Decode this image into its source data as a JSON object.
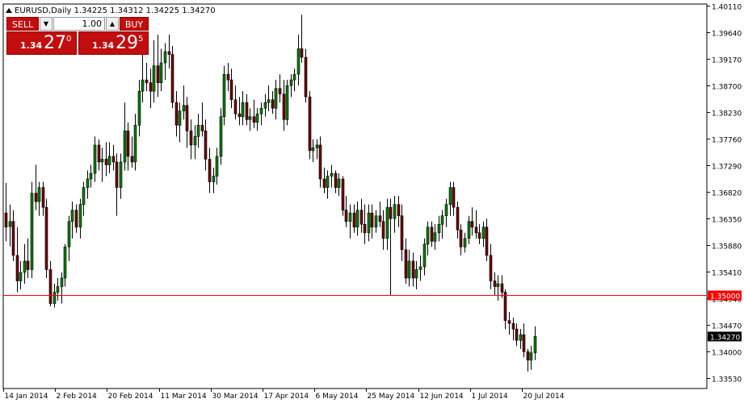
{
  "window": {
    "header_text": "EURUSD,Daily  1.34225 1.34312 1.34225 1.34270"
  },
  "trade_panel": {
    "sell_label": "SELL",
    "buy_label": "BUY",
    "lot_value": "1.00",
    "sell_price_prefix": "1.34",
    "sell_price_big": "27",
    "sell_price_super": "0",
    "buy_price_prefix": "1.34",
    "buy_price_big": "29",
    "buy_price_super": "5"
  },
  "chart_data": {
    "type": "candlestick",
    "symbol": "EURUSD",
    "timeframe": "Daily",
    "ohlc_header": {
      "open": 1.34225,
      "high": 1.34312,
      "low": 1.34225,
      "close": 1.3427
    },
    "x_tick_labels": [
      "14 Jan 2014",
      "2 Feb 2014",
      "20 Feb 2014",
      "11 Mar 2014",
      "30 Mar 2014",
      "17 Apr 2014",
      "6 May 2014",
      "25 May 2014",
      "12 Jun 2014",
      "1 Jul 2014",
      "20 Jul 2014"
    ],
    "y_tick_labels": [
      "1.40110",
      "1.39640",
      "1.39170",
      "1.38700",
      "1.38230",
      "1.37760",
      "1.37290",
      "1.36820",
      "1.36350",
      "1.35880",
      "1.35410",
      "1.34940",
      "1.34470",
      "1.34000",
      "1.33530"
    ],
    "y_range": [
      1.3335,
      1.4014
    ],
    "horizontal_line": {
      "value": 1.35,
      "label": "1.35000",
      "color": "#ff0000"
    },
    "current_price_label": "1.34270",
    "colors": {
      "bull": "#0a7a0a",
      "bear": "#6b0000",
      "wick": "#000000",
      "hline": "#ff0000",
      "label_bg": "#000000",
      "label_text": "#ffffff"
    },
    "candles": [
      {
        "o": 1.3645,
        "h": 1.3698,
        "l": 1.3595,
        "c": 1.362
      },
      {
        "o": 1.3621,
        "h": 1.366,
        "l": 1.3586,
        "c": 1.363
      },
      {
        "o": 1.363,
        "h": 1.365,
        "l": 1.356,
        "c": 1.357
      },
      {
        "o": 1.357,
        "h": 1.362,
        "l": 1.3505,
        "c": 1.3525
      },
      {
        "o": 1.3525,
        "h": 1.356,
        "l": 1.351,
        "c": 1.354
      },
      {
        "o": 1.354,
        "h": 1.359,
        "l": 1.352,
        "c": 1.356
      },
      {
        "o": 1.356,
        "h": 1.36,
        "l": 1.353,
        "c": 1.3545
      },
      {
        "o": 1.3545,
        "h": 1.37,
        "l": 1.353,
        "c": 1.368
      },
      {
        "o": 1.368,
        "h": 1.373,
        "l": 1.365,
        "c": 1.3665
      },
      {
        "o": 1.3665,
        "h": 1.37,
        "l": 1.364,
        "c": 1.369
      },
      {
        "o": 1.369,
        "h": 1.37,
        "l": 1.364,
        "c": 1.3655
      },
      {
        "o": 1.3655,
        "h": 1.367,
        "l": 1.353,
        "c": 1.3545
      },
      {
        "o": 1.3545,
        "h": 1.356,
        "l": 1.348,
        "c": 1.3485
      },
      {
        "o": 1.3485,
        "h": 1.352,
        "l": 1.3478,
        "c": 1.3505
      },
      {
        "o": 1.3505,
        "h": 1.353,
        "l": 1.349,
        "c": 1.3515
      },
      {
        "o": 1.3515,
        "h": 1.354,
        "l": 1.3485,
        "c": 1.353
      },
      {
        "o": 1.353,
        "h": 1.359,
        "l": 1.3515,
        "c": 1.3585
      },
      {
        "o": 1.3585,
        "h": 1.364,
        "l": 1.356,
        "c": 1.363
      },
      {
        "o": 1.363,
        "h": 1.3665,
        "l": 1.36,
        "c": 1.365
      },
      {
        "o": 1.365,
        "h": 1.366,
        "l": 1.361,
        "c": 1.362
      },
      {
        "o": 1.362,
        "h": 1.367,
        "l": 1.36,
        "c": 1.366
      },
      {
        "o": 1.366,
        "h": 1.37,
        "l": 1.364,
        "c": 1.369
      },
      {
        "o": 1.369,
        "h": 1.372,
        "l": 1.367,
        "c": 1.3705
      },
      {
        "o": 1.3705,
        "h": 1.373,
        "l": 1.369,
        "c": 1.3715
      },
      {
        "o": 1.3715,
        "h": 1.378,
        "l": 1.37,
        "c": 1.3765
      },
      {
        "o": 1.3765,
        "h": 1.3775,
        "l": 1.372,
        "c": 1.3735
      },
      {
        "o": 1.3735,
        "h": 1.376,
        "l": 1.37,
        "c": 1.374
      },
      {
        "o": 1.374,
        "h": 1.377,
        "l": 1.371,
        "c": 1.373
      },
      {
        "o": 1.373,
        "h": 1.377,
        "l": 1.3715,
        "c": 1.3745
      },
      {
        "o": 1.3745,
        "h": 1.3765,
        "l": 1.372,
        "c": 1.3735
      },
      {
        "o": 1.3735,
        "h": 1.375,
        "l": 1.364,
        "c": 1.369
      },
      {
        "o": 1.369,
        "h": 1.375,
        "l": 1.367,
        "c": 1.3735
      },
      {
        "o": 1.3735,
        "h": 1.384,
        "l": 1.372,
        "c": 1.379
      },
      {
        "o": 1.379,
        "h": 1.3805,
        "l": 1.372,
        "c": 1.3745
      },
      {
        "o": 1.3745,
        "h": 1.378,
        "l": 1.3725,
        "c": 1.3735
      },
      {
        "o": 1.3735,
        "h": 1.382,
        "l": 1.372,
        "c": 1.38
      },
      {
        "o": 1.38,
        "h": 1.388,
        "l": 1.378,
        "c": 1.386
      },
      {
        "o": 1.386,
        "h": 1.393,
        "l": 1.384,
        "c": 1.388
      },
      {
        "o": 1.388,
        "h": 1.391,
        "l": 1.386,
        "c": 1.3875
      },
      {
        "o": 1.3875,
        "h": 1.39,
        "l": 1.383,
        "c": 1.386
      },
      {
        "o": 1.386,
        "h": 1.395,
        "l": 1.384,
        "c": 1.3905
      },
      {
        "o": 1.3905,
        "h": 1.396,
        "l": 1.385,
        "c": 1.3875
      },
      {
        "o": 1.3875,
        "h": 1.3935,
        "l": 1.386,
        "c": 1.391
      },
      {
        "o": 1.391,
        "h": 1.3945,
        "l": 1.388,
        "c": 1.393
      },
      {
        "o": 1.393,
        "h": 1.396,
        "l": 1.39,
        "c": 1.3925
      },
      {
        "o": 1.3925,
        "h": 1.394,
        "l": 1.383,
        "c": 1.384
      },
      {
        "o": 1.384,
        "h": 1.386,
        "l": 1.378,
        "c": 1.38
      },
      {
        "o": 1.38,
        "h": 1.384,
        "l": 1.377,
        "c": 1.3825
      },
      {
        "o": 1.3825,
        "h": 1.387,
        "l": 1.381,
        "c": 1.3835
      },
      {
        "o": 1.3835,
        "h": 1.385,
        "l": 1.376,
        "c": 1.379
      },
      {
        "o": 1.379,
        "h": 1.381,
        "l": 1.374,
        "c": 1.3765
      },
      {
        "o": 1.3765,
        "h": 1.38,
        "l": 1.374,
        "c": 1.378
      },
      {
        "o": 1.378,
        "h": 1.382,
        "l": 1.376,
        "c": 1.38
      },
      {
        "o": 1.38,
        "h": 1.384,
        "l": 1.378,
        "c": 1.379
      },
      {
        "o": 1.379,
        "h": 1.381,
        "l": 1.372,
        "c": 1.374
      },
      {
        "o": 1.374,
        "h": 1.376,
        "l": 1.368,
        "c": 1.37
      },
      {
        "o": 1.37,
        "h": 1.3725,
        "l": 1.368,
        "c": 1.371
      },
      {
        "o": 1.371,
        "h": 1.376,
        "l": 1.3695,
        "c": 1.3745
      },
      {
        "o": 1.3745,
        "h": 1.383,
        "l": 1.373,
        "c": 1.3815
      },
      {
        "o": 1.3815,
        "h": 1.3905,
        "l": 1.38,
        "c": 1.389
      },
      {
        "o": 1.389,
        "h": 1.391,
        "l": 1.386,
        "c": 1.388
      },
      {
        "o": 1.388,
        "h": 1.39,
        "l": 1.383,
        "c": 1.3845
      },
      {
        "o": 1.3845,
        "h": 1.387,
        "l": 1.381,
        "c": 1.382
      },
      {
        "o": 1.382,
        "h": 1.385,
        "l": 1.38,
        "c": 1.3815
      },
      {
        "o": 1.3815,
        "h": 1.386,
        "l": 1.38,
        "c": 1.384
      },
      {
        "o": 1.384,
        "h": 1.3855,
        "l": 1.38,
        "c": 1.381
      },
      {
        "o": 1.381,
        "h": 1.383,
        "l": 1.379,
        "c": 1.3815
      },
      {
        "o": 1.3815,
        "h": 1.3845,
        "l": 1.3795,
        "c": 1.3805
      },
      {
        "o": 1.3805,
        "h": 1.383,
        "l": 1.379,
        "c": 1.382
      },
      {
        "o": 1.382,
        "h": 1.384,
        "l": 1.38,
        "c": 1.383
      },
      {
        "o": 1.383,
        "h": 1.3855,
        "l": 1.3815,
        "c": 1.384
      },
      {
        "o": 1.384,
        "h": 1.387,
        "l": 1.3825,
        "c": 1.3845
      },
      {
        "o": 1.3845,
        "h": 1.386,
        "l": 1.382,
        "c": 1.383
      },
      {
        "o": 1.383,
        "h": 1.388,
        "l": 1.381,
        "c": 1.3865
      },
      {
        "o": 1.3865,
        "h": 1.389,
        "l": 1.384,
        "c": 1.3855
      },
      {
        "o": 1.3855,
        "h": 1.388,
        "l": 1.379,
        "c": 1.381
      },
      {
        "o": 1.381,
        "h": 1.388,
        "l": 1.38,
        "c": 1.387
      },
      {
        "o": 1.387,
        "h": 1.389,
        "l": 1.385,
        "c": 1.388
      },
      {
        "o": 1.388,
        "h": 1.39,
        "l": 1.386,
        "c": 1.389
      },
      {
        "o": 1.389,
        "h": 1.396,
        "l": 1.387,
        "c": 1.3935
      },
      {
        "o": 1.3935,
        "h": 1.3995,
        "l": 1.391,
        "c": 1.392
      },
      {
        "o": 1.392,
        "h": 1.3935,
        "l": 1.384,
        "c": 1.385
      },
      {
        "o": 1.385,
        "h": 1.386,
        "l": 1.374,
        "c": 1.3755
      },
      {
        "o": 1.3755,
        "h": 1.3775,
        "l": 1.3735,
        "c": 1.376
      },
      {
        "o": 1.376,
        "h": 1.3775,
        "l": 1.374,
        "c": 1.3765
      },
      {
        "o": 1.3765,
        "h": 1.378,
        "l": 1.369,
        "c": 1.3705
      },
      {
        "o": 1.3705,
        "h": 1.3725,
        "l": 1.368,
        "c": 1.369
      },
      {
        "o": 1.369,
        "h": 1.372,
        "l": 1.367,
        "c": 1.371
      },
      {
        "o": 1.371,
        "h": 1.373,
        "l": 1.369,
        "c": 1.3715
      },
      {
        "o": 1.3715,
        "h": 1.372,
        "l": 1.368,
        "c": 1.369
      },
      {
        "o": 1.369,
        "h": 1.3715,
        "l": 1.3675,
        "c": 1.3705
      },
      {
        "o": 1.3705,
        "h": 1.371,
        "l": 1.364,
        "c": 1.365
      },
      {
        "o": 1.365,
        "h": 1.3675,
        "l": 1.362,
        "c": 1.363
      },
      {
        "o": 1.363,
        "h": 1.366,
        "l": 1.36,
        "c": 1.3645
      },
      {
        "o": 1.3645,
        "h": 1.366,
        "l": 1.361,
        "c": 1.362
      },
      {
        "o": 1.362,
        "h": 1.3665,
        "l": 1.3605,
        "c": 1.365
      },
      {
        "o": 1.365,
        "h": 1.367,
        "l": 1.361,
        "c": 1.3625
      },
      {
        "o": 1.3625,
        "h": 1.366,
        "l": 1.359,
        "c": 1.361
      },
      {
        "o": 1.361,
        "h": 1.366,
        "l": 1.3595,
        "c": 1.3645
      },
      {
        "o": 1.3645,
        "h": 1.366,
        "l": 1.36,
        "c": 1.362
      },
      {
        "o": 1.362,
        "h": 1.365,
        "l": 1.361,
        "c": 1.364
      },
      {
        "o": 1.364,
        "h": 1.3665,
        "l": 1.362,
        "c": 1.363
      },
      {
        "o": 1.363,
        "h": 1.365,
        "l": 1.358,
        "c": 1.36
      },
      {
        "o": 1.36,
        "h": 1.367,
        "l": 1.358,
        "c": 1.3655
      },
      {
        "o": 1.3655,
        "h": 1.367,
        "l": 1.35,
        "c": 1.3635
      },
      {
        "o": 1.3635,
        "h": 1.3675,
        "l": 1.361,
        "c": 1.366
      },
      {
        "o": 1.366,
        "h": 1.3675,
        "l": 1.362,
        "c": 1.364
      },
      {
        "o": 1.364,
        "h": 1.366,
        "l": 1.356,
        "c": 1.358
      },
      {
        "o": 1.358,
        "h": 1.36,
        "l": 1.352,
        "c": 1.353
      },
      {
        "o": 1.353,
        "h": 1.358,
        "l": 1.3515,
        "c": 1.356
      },
      {
        "o": 1.356,
        "h": 1.3575,
        "l": 1.3515,
        "c": 1.353
      },
      {
        "o": 1.353,
        "h": 1.356,
        "l": 1.351,
        "c": 1.3545
      },
      {
        "o": 1.3545,
        "h": 1.357,
        "l": 1.3525,
        "c": 1.355
      },
      {
        "o": 1.355,
        "h": 1.36,
        "l": 1.3535,
        "c": 1.359
      },
      {
        "o": 1.359,
        "h": 1.363,
        "l": 1.357,
        "c": 1.362
      },
      {
        "o": 1.362,
        "h": 1.363,
        "l": 1.3585,
        "c": 1.3595
      },
      {
        "o": 1.3595,
        "h": 1.3625,
        "l": 1.358,
        "c": 1.361
      },
      {
        "o": 1.361,
        "h": 1.364,
        "l": 1.3595,
        "c": 1.3625
      },
      {
        "o": 1.3625,
        "h": 1.365,
        "l": 1.36,
        "c": 1.364
      },
      {
        "o": 1.364,
        "h": 1.367,
        "l": 1.362,
        "c": 1.366
      },
      {
        "o": 1.366,
        "h": 1.37,
        "l": 1.364,
        "c": 1.369
      },
      {
        "o": 1.369,
        "h": 1.37,
        "l": 1.364,
        "c": 1.3655
      },
      {
        "o": 1.3655,
        "h": 1.3665,
        "l": 1.36,
        "c": 1.3615
      },
      {
        "o": 1.3615,
        "h": 1.3625,
        "l": 1.357,
        "c": 1.3585
      },
      {
        "o": 1.3585,
        "h": 1.361,
        "l": 1.3575,
        "c": 1.36
      },
      {
        "o": 1.36,
        "h": 1.364,
        "l": 1.359,
        "c": 1.363
      },
      {
        "o": 1.363,
        "h": 1.3655,
        "l": 1.3605,
        "c": 1.362
      },
      {
        "o": 1.362,
        "h": 1.365,
        "l": 1.36,
        "c": 1.361
      },
      {
        "o": 1.361,
        "h": 1.3625,
        "l": 1.359,
        "c": 1.36
      },
      {
        "o": 1.36,
        "h": 1.363,
        "l": 1.3585,
        "c": 1.362
      },
      {
        "o": 1.362,
        "h": 1.3635,
        "l": 1.356,
        "c": 1.357
      },
      {
        "o": 1.357,
        "h": 1.359,
        "l": 1.351,
        "c": 1.3525
      },
      {
        "o": 1.3525,
        "h": 1.354,
        "l": 1.35,
        "c": 1.3515
      },
      {
        "o": 1.3515,
        "h": 1.3535,
        "l": 1.349,
        "c": 1.352
      },
      {
        "o": 1.352,
        "h": 1.3535,
        "l": 1.3495,
        "c": 1.3505
      },
      {
        "o": 1.3505,
        "h": 1.351,
        "l": 1.344,
        "c": 1.3455
      },
      {
        "o": 1.3455,
        "h": 1.347,
        "l": 1.343,
        "c": 1.345
      },
      {
        "o": 1.345,
        "h": 1.346,
        "l": 1.342,
        "c": 1.344
      },
      {
        "o": 1.344,
        "h": 1.345,
        "l": 1.341,
        "c": 1.342
      },
      {
        "o": 1.342,
        "h": 1.344,
        "l": 1.3405,
        "c": 1.343
      },
      {
        "o": 1.343,
        "h": 1.345,
        "l": 1.339,
        "c": 1.34
      },
      {
        "o": 1.34,
        "h": 1.3405,
        "l": 1.3365,
        "c": 1.3385
      },
      {
        "o": 1.3385,
        "h": 1.341,
        "l": 1.3368,
        "c": 1.3398
      },
      {
        "o": 1.3398,
        "h": 1.3445,
        "l": 1.3385,
        "c": 1.3427
      }
    ]
  }
}
